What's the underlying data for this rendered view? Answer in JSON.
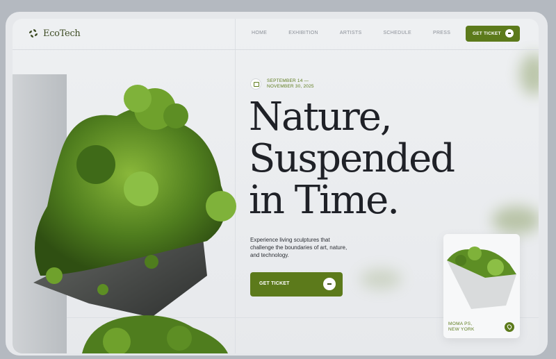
{
  "brand": {
    "name": "EcoTech"
  },
  "nav": {
    "items": [
      "HOME",
      "EXHIBITION",
      "ARTISTS",
      "SCHEDULE",
      "PRESS"
    ]
  },
  "header": {
    "cta_label": "GET TICKET"
  },
  "hero": {
    "date_line1": "SEPTEMBER 14 —",
    "date_line2": "NOVEMBER 30, 2025",
    "headline_line1": "Nature,",
    "headline_line2": "Suspended",
    "headline_line3": "in Time.",
    "description": "Experience living sculptures that challenge the boundaries of art, nature, and technology.",
    "cta_label": "GET TICKET"
  },
  "card": {
    "location_line1": "MOMA PS,",
    "location_line2": "NEW YORK"
  },
  "colors": {
    "accent": "#5c7a1b",
    "text": "#1f2127",
    "background": "#eef0f2"
  },
  "icons": {
    "logo": "leaf-swirl-icon",
    "calendar": "calendar-icon",
    "cta_arrow": "arrow-right-icon",
    "location": "map-pin-icon"
  }
}
